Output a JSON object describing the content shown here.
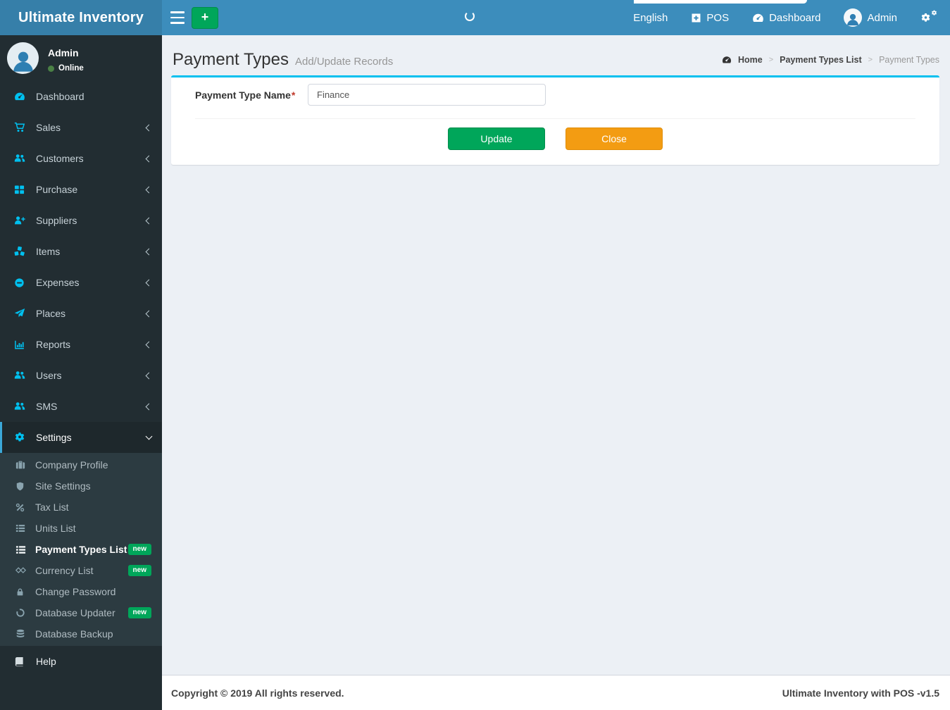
{
  "app": {
    "title": "Ultimate Inventory"
  },
  "topbar": {
    "language_label": "English",
    "pos_label": "POS",
    "dashboard_label": "Dashboard",
    "user_label": "Admin",
    "icons": [
      "hamburger-icon",
      "plus-icon",
      "spinner-icon",
      "plus-square-icon",
      "gauge-icon",
      "avatar-icon",
      "gears-icon"
    ]
  },
  "sidebar": {
    "user": {
      "name": "Admin",
      "status": "Online"
    },
    "items": [
      {
        "label": "Dashboard",
        "icon": "gauge-icon"
      },
      {
        "label": "Sales",
        "icon": "cart-icon"
      },
      {
        "label": "Customers",
        "icon": "users-icon"
      },
      {
        "label": "Purchase",
        "icon": "grid-icon"
      },
      {
        "label": "Suppliers",
        "icon": "user-plus-icon"
      },
      {
        "label": "Items",
        "icon": "cubes-icon"
      },
      {
        "label": "Expenses",
        "icon": "minus-circle-icon"
      },
      {
        "label": "Places",
        "icon": "paper-plane-icon"
      },
      {
        "label": "Reports",
        "icon": "bar-chart-icon"
      },
      {
        "label": "Users",
        "icon": "users-icon"
      },
      {
        "label": "SMS",
        "icon": "users-icon"
      },
      {
        "label": "Settings",
        "icon": "gear-icon",
        "expanded": true
      }
    ],
    "settings_submenu": [
      {
        "label": "Company Profile",
        "icon": "briefcase-icon"
      },
      {
        "label": "Site Settings",
        "icon": "shield-icon"
      },
      {
        "label": "Tax List",
        "icon": "percent-icon"
      },
      {
        "label": "Units List",
        "icon": "list-icon"
      },
      {
        "label": "Payment Types List",
        "icon": "list-icon",
        "badge": "new",
        "active": true
      },
      {
        "label": "Currency List",
        "icon": "diamonds-icon",
        "badge": "new"
      },
      {
        "label": "Change Password",
        "icon": "lock-icon"
      },
      {
        "label": "Database Updater",
        "icon": "circle-notch-icon",
        "badge": "new"
      },
      {
        "label": "Database Backup",
        "icon": "database-icon"
      }
    ],
    "help_label": "Help"
  },
  "page": {
    "title": "Payment Types",
    "subtitle": "Add/Update Records",
    "breadcrumb": {
      "home": "Home",
      "parent": "Payment Types List",
      "current": "Payment Types"
    }
  },
  "form": {
    "field_label": "Payment Type Name",
    "required_mark": "*",
    "field_value": "Finance",
    "update_label": "Update",
    "close_label": "Close"
  },
  "footer": {
    "copyright": "Copyright © 2019 All rights reserved.",
    "version": "Ultimate Inventory with POS -v1.5"
  },
  "colors": {
    "navbar_blue": "#3c8dbc",
    "logo_blue": "#367fa9",
    "sidebar_dark": "#222d32",
    "submenu_dark": "#2c3b41",
    "active_item_dark": "#1e282c",
    "accent_cyan": "#00c0ef",
    "success_green": "#00a65a",
    "warning_orange": "#f39c12",
    "content_bg": "#ecf0f5"
  }
}
